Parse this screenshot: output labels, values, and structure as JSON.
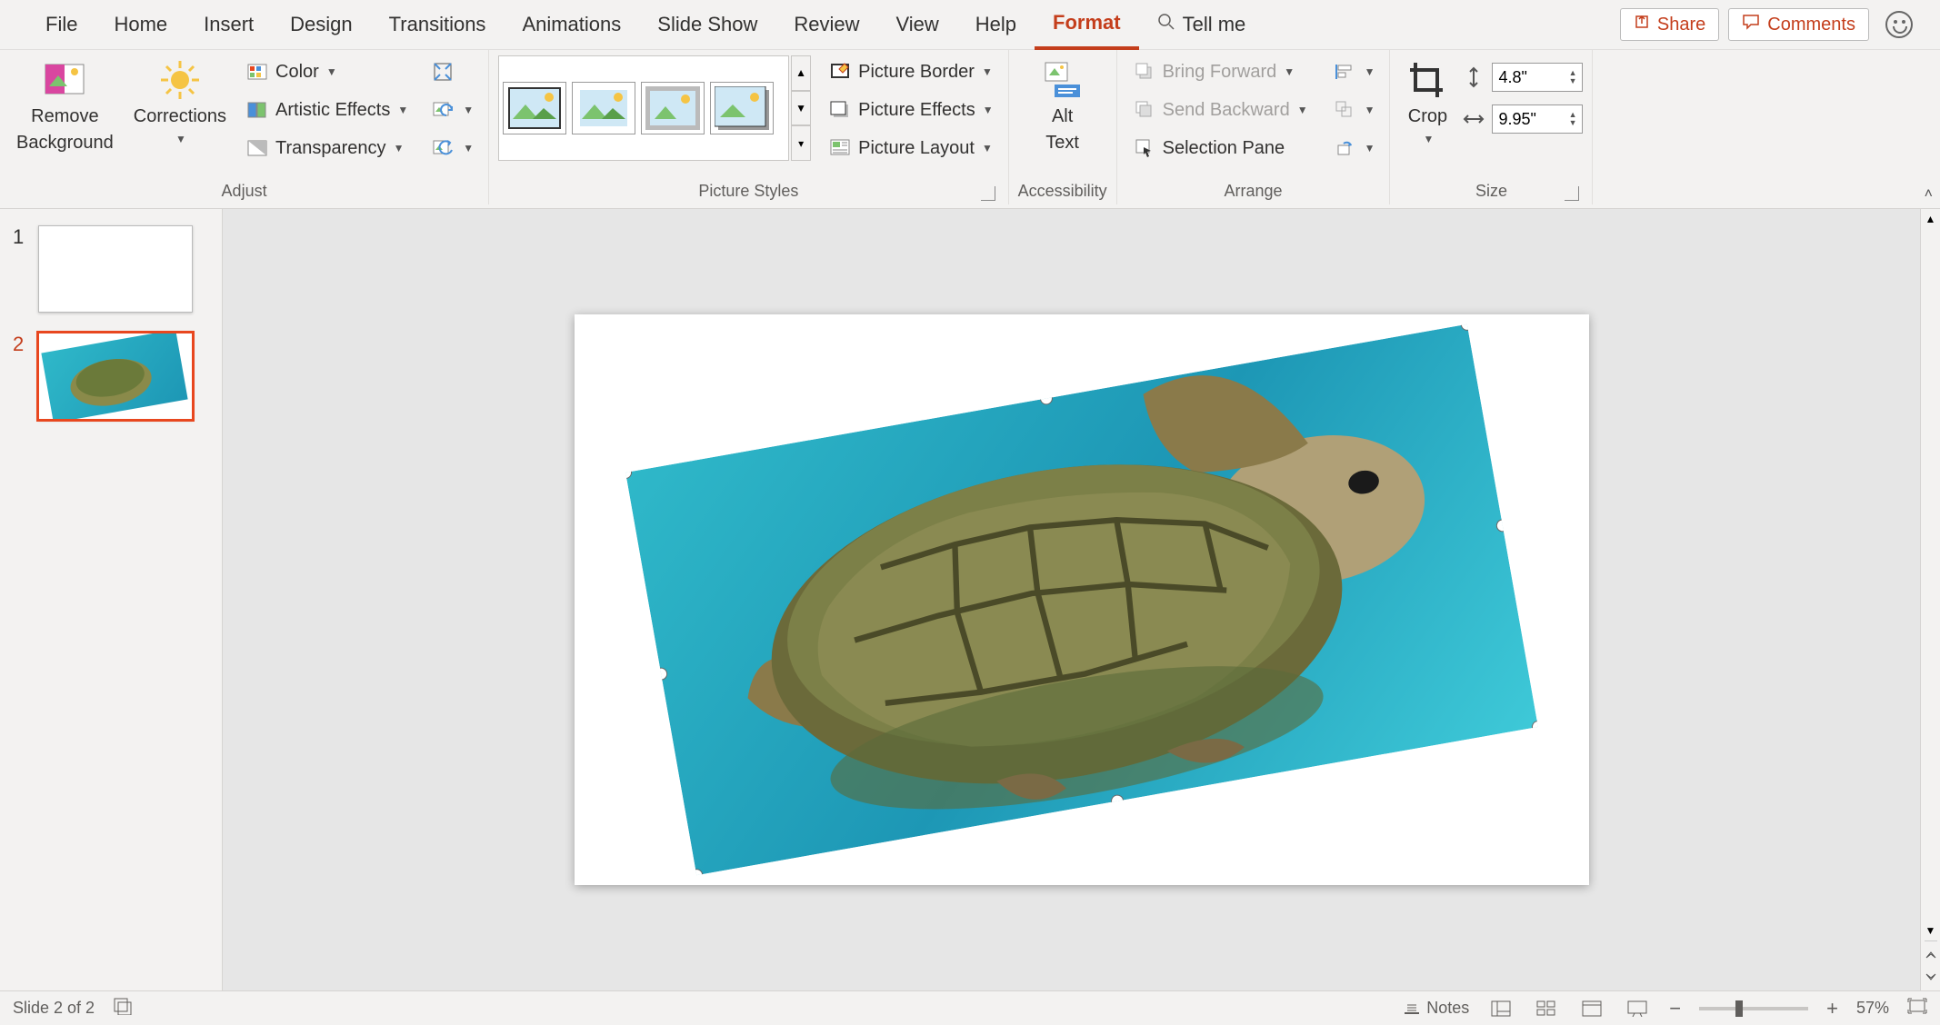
{
  "tabs": {
    "file": "File",
    "home": "Home",
    "insert": "Insert",
    "design": "Design",
    "transitions": "Transitions",
    "animations": "Animations",
    "slideshow": "Slide Show",
    "review": "Review",
    "view": "View",
    "help": "Help",
    "format": "Format",
    "tellme": "Tell me"
  },
  "titlebar": {
    "share": "Share",
    "comments": "Comments"
  },
  "ribbon": {
    "adjust": {
      "label": "Adjust",
      "remove_bg_1": "Remove",
      "remove_bg_2": "Background",
      "corrections": "Corrections",
      "color": "Color",
      "artistic": "Artistic Effects",
      "transparency": "Transparency"
    },
    "styles": {
      "label": "Picture Styles",
      "border": "Picture Border",
      "effects": "Picture Effects",
      "layout": "Picture Layout"
    },
    "accessibility": {
      "label": "Accessibility",
      "alt1": "Alt",
      "alt2": "Text"
    },
    "arrange": {
      "label": "Arrange",
      "forward": "Bring Forward",
      "backward": "Send Backward",
      "selection": "Selection Pane"
    },
    "size": {
      "label": "Size",
      "crop": "Crop",
      "height_val": "4.8\"",
      "width_val": "9.95\""
    }
  },
  "thumbs": {
    "n1": "1",
    "n2": "2"
  },
  "status": {
    "slide_info": "Slide 2 of 2",
    "notes": "Notes",
    "zoom_pct": "57%"
  }
}
